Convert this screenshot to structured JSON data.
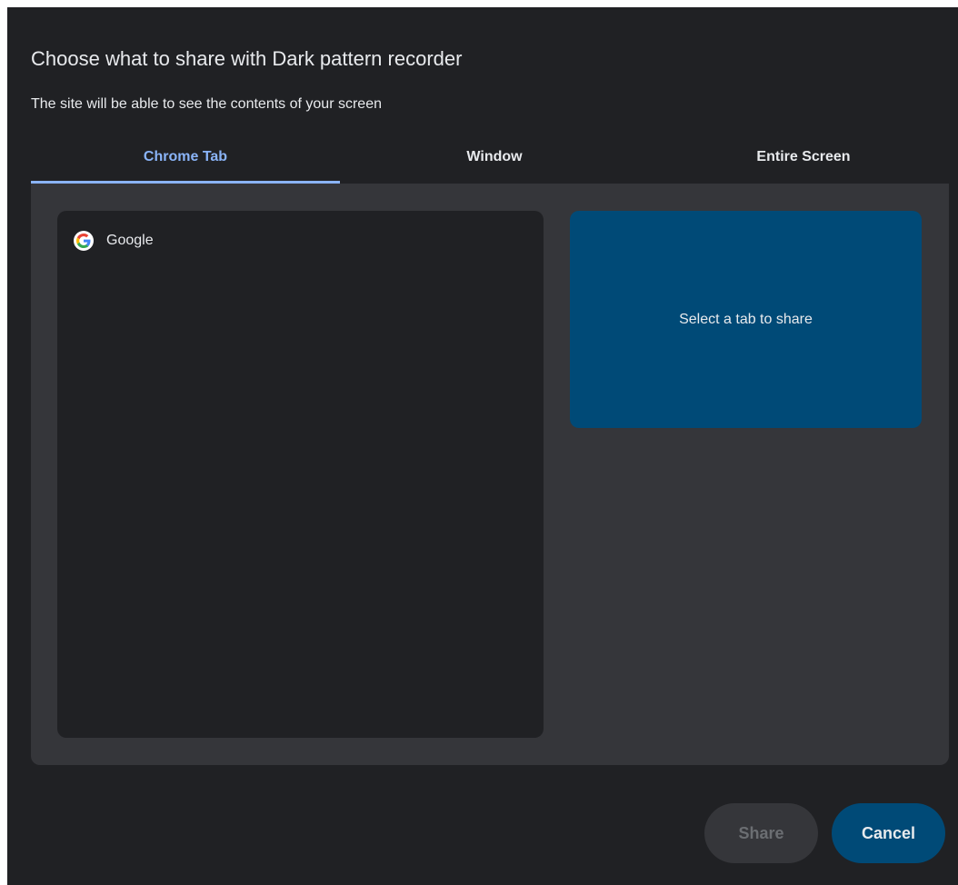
{
  "dialog": {
    "title": "Choose what to share with Dark pattern recorder",
    "subtitle": "The site will be able to see the contents of your screen"
  },
  "tabs": [
    {
      "label": "Chrome Tab",
      "active": true
    },
    {
      "label": "Window",
      "active": false
    },
    {
      "label": "Entire Screen",
      "active": false
    }
  ],
  "tab_list": {
    "items": [
      {
        "label": "Google",
        "icon": "google-favicon-icon"
      }
    ]
  },
  "preview": {
    "message": "Select a tab to share"
  },
  "buttons": {
    "share_label": "Share",
    "cancel_label": "Cancel"
  },
  "colors": {
    "background": "#202124",
    "panel": "#35363a",
    "accent": "#8ab4f8",
    "preview": "#004a77"
  }
}
